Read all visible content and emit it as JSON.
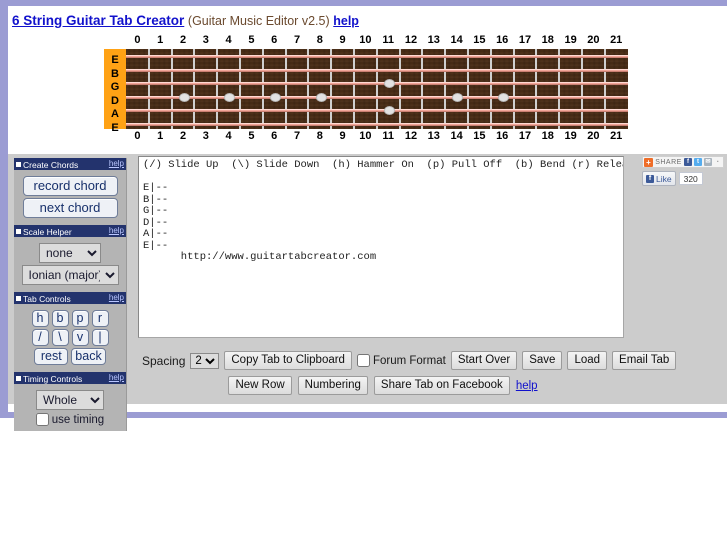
{
  "header": {
    "title_link": "6 String Guitar Tab Creator",
    "subtitle": "(Guitar Music Editor v2.5)",
    "help_label": "help"
  },
  "fretboard": {
    "fret_numbers": [
      "0",
      "1",
      "2",
      "3",
      "4",
      "5",
      "6",
      "7",
      "8",
      "9",
      "10",
      "11",
      "12",
      "13",
      "14",
      "15",
      "16",
      "17",
      "18",
      "19",
      "20",
      "21"
    ],
    "string_labels": [
      "E",
      "B",
      "G",
      "D",
      "A",
      "E"
    ],
    "marker_dots": [
      {
        "fret": 3,
        "lane": 3
      },
      {
        "fret": 5,
        "lane": 3
      },
      {
        "fret": 7,
        "lane": 3
      },
      {
        "fret": 9,
        "lane": 3
      },
      {
        "fret": 12,
        "lane": 2
      },
      {
        "fret": 12,
        "lane": 4
      },
      {
        "fret": 15,
        "lane": 3
      },
      {
        "fret": 17,
        "lane": 3
      }
    ]
  },
  "sidebar": {
    "create_chords": {
      "title": "Create Chords",
      "help": "help",
      "record_chord": "record chord",
      "next_chord": "next chord"
    },
    "scale_helper": {
      "title": "Scale Helper",
      "help": "help",
      "root_value": "none",
      "root_options": [
        "none"
      ],
      "mode_value": "Ionian (major)",
      "mode_options": [
        "Ionian (major)"
      ]
    },
    "tab_controls": {
      "title": "Tab Controls",
      "help": "help",
      "row1": [
        "h",
        "b",
        "p",
        "r"
      ],
      "row2": [
        "/",
        "\\",
        "v",
        "|"
      ],
      "row3": [
        "rest",
        "back"
      ]
    },
    "timing_controls": {
      "title": "Timing Controls",
      "help": "help",
      "note_value": "Whole",
      "note_options": [
        "Whole"
      ],
      "use_timing_label": "use timing",
      "use_timing_checked": false
    }
  },
  "editor": {
    "legend": "(/) Slide Up  (\\) Slide Down  (h) Hammer On  (p) Pull Off  (b) Bend (r) Release (v) Vibrato",
    "tab_lines": [
      "E|--",
      "B|--",
      "G|--",
      "D|--",
      "A|--",
      "E|--"
    ],
    "footer_url": "http://www.guitartabcreator.com",
    "textarea_value": "(/) Slide Up  (\\) Slide Down  (h) Hammer On  (p) Pull Off  (b) Bend (r) Release (v) Vibrato\n\nE|--\nB|--\nG|--\nD|--\nA|--\nE|--\n      http://www.guitartabcreator.com"
  },
  "controls": {
    "spacing_label": "Spacing",
    "spacing_value": "2",
    "spacing_options": [
      "2"
    ],
    "copy_tab": "Copy Tab to Clipboard",
    "forum_format_label": "Forum Format",
    "forum_format_checked": false,
    "start_over": "Start Over",
    "save": "Save",
    "load": "Load",
    "email_tab": "Email Tab",
    "new_row": "New Row",
    "numbering": "Numbering",
    "share_facebook": "Share Tab on Facebook",
    "help": "help"
  },
  "share": {
    "share_label": "SHARE",
    "plus_label": "+",
    "facebook_icon_label": "f",
    "twitter_icon_label": "t",
    "mail_icon_label": "✉",
    "more_icon_label": "·",
    "like_label": "Like",
    "like_count": "320"
  },
  "colors": {
    "page_background": "#9b9cd3",
    "app_background": "#cccccc",
    "panel_header": "#23336d",
    "nut": "#ffa215",
    "fretboard_wood": "#4b2d16",
    "string": "#f0a598",
    "link": "#1111cc"
  }
}
